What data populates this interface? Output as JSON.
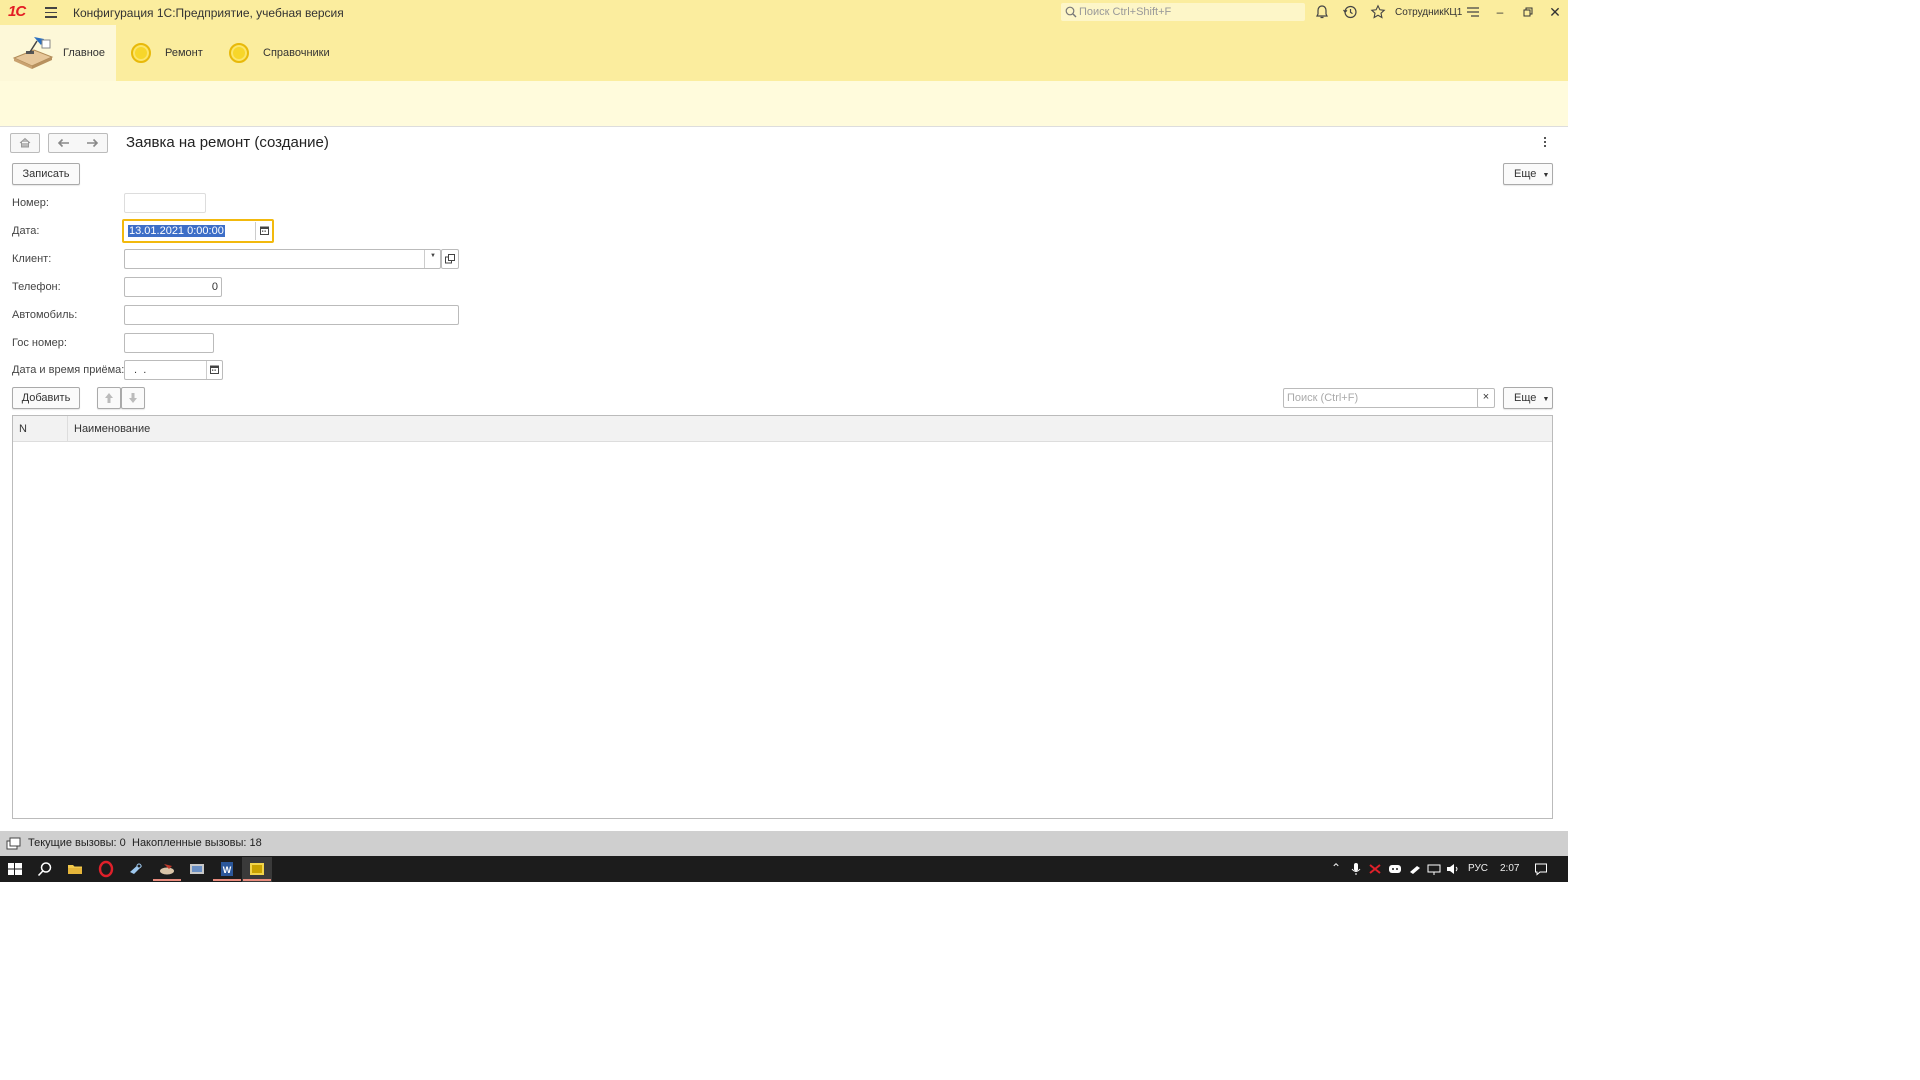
{
  "window": {
    "title": "Конфигурация 1С:Предприятие, учебная версия",
    "logo_text": "1С",
    "search_placeholder": "Поиск Ctrl+Shift+F",
    "user": "СотрудникКЦ1"
  },
  "sections": [
    {
      "label": "Главное",
      "active": true
    },
    {
      "label": "Ремонт",
      "active": false
    },
    {
      "label": "Справочники",
      "active": false
    }
  ],
  "form": {
    "title": "Заявка на ремонт (создание)",
    "save_button": "Записать",
    "more_button": "Еще",
    "fields": {
      "number_label": "Номер:",
      "number_value": "",
      "date_label": "Дата:",
      "date_value": "13.01.2021  0:00:00",
      "client_label": "Клиент:",
      "client_value": "",
      "phone_label": "Телефон:",
      "phone_value": "0",
      "car_label": "Автомобиль:",
      "car_value": "",
      "plate_label": "Гос номер:",
      "plate_value": "",
      "reception_label": "Дата и время приёма:",
      "reception_value": " .  ."
    }
  },
  "table": {
    "add_button": "Добавить",
    "search_placeholder": "Поиск (Ctrl+F)",
    "more_button": "Еще",
    "clear_icon": "×",
    "columns": [
      "N",
      "Наименование"
    ],
    "rows": []
  },
  "statusbar": {
    "current_calls": "Текущие вызовы: 0",
    "accumulated_calls": "Накопленные вызовы: 18"
  },
  "taskbar": {
    "language": "РУС",
    "time": "2:07"
  },
  "colors": {
    "panel_yellow": "#fbed9e",
    "focus_border": "#f2b90d",
    "selection": "#3d6ec7"
  }
}
